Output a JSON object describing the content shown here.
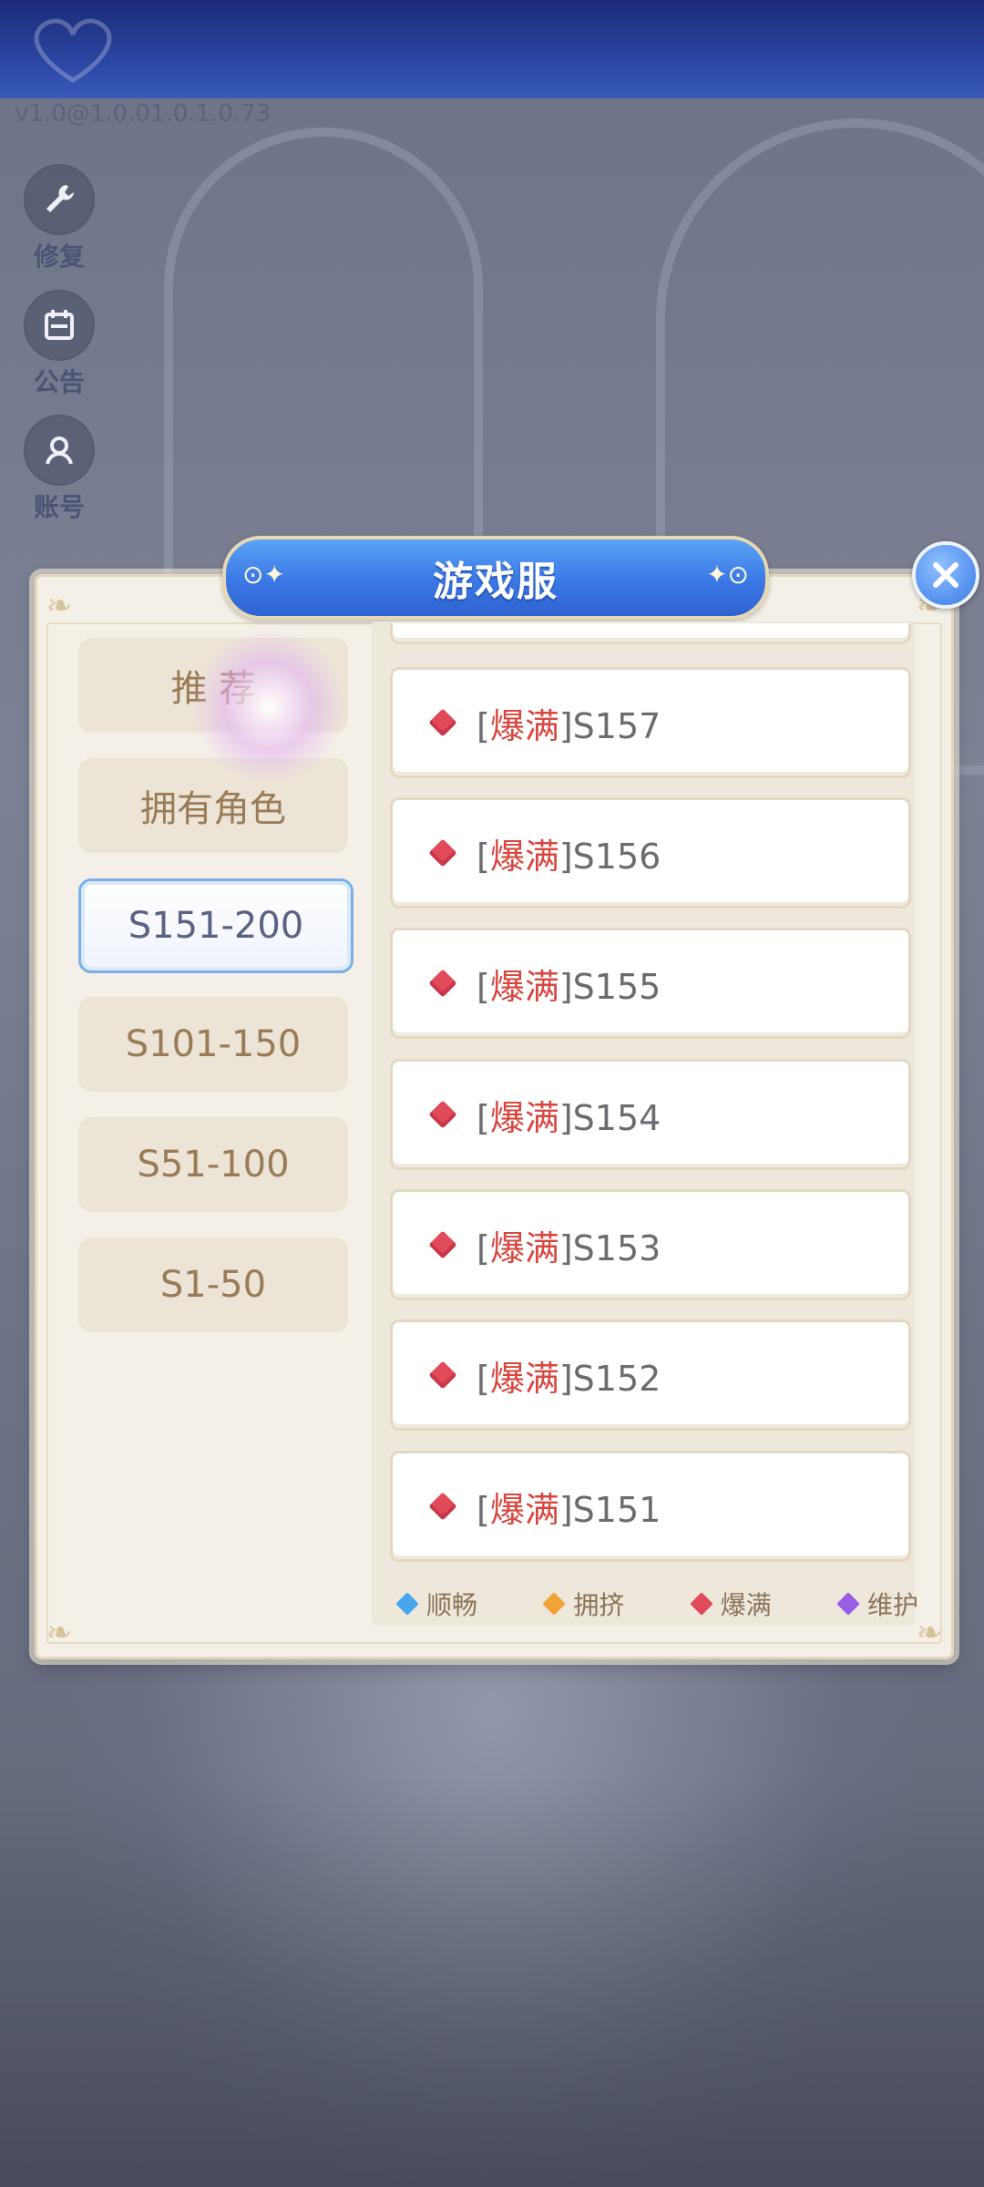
{
  "app": {
    "version": "v1.0@1.0.01.0.1.0.73"
  },
  "side_menu": [
    {
      "label": "修复",
      "icon": "wrench-icon"
    },
    {
      "label": "公告",
      "icon": "calendar-icon"
    },
    {
      "label": "账号",
      "icon": "account-icon"
    }
  ],
  "dialog": {
    "title": "游戏服",
    "close_icon": "close-icon"
  },
  "tabs": [
    {
      "label": "推 荐",
      "active": false
    },
    {
      "label": "拥有角色",
      "active": false
    },
    {
      "label": "S151-200",
      "active": true
    },
    {
      "label": "S101-150",
      "active": false
    },
    {
      "label": "S51-100",
      "active": false
    },
    {
      "label": "S1-50",
      "active": false
    }
  ],
  "servers": [
    {
      "bracket_open": "[",
      "status": "爆满",
      "name": "]S157"
    },
    {
      "bracket_open": "[",
      "status": "爆满",
      "name": "]S156"
    },
    {
      "bracket_open": "[",
      "status": "爆满",
      "name": "]S155"
    },
    {
      "bracket_open": "[",
      "status": "爆满",
      "name": "]S154"
    },
    {
      "bracket_open": "[",
      "status": "爆满",
      "name": "]S153"
    },
    {
      "bracket_open": "[",
      "status": "爆满",
      "name": "]S152"
    },
    {
      "bracket_open": "[",
      "status": "爆满",
      "name": "]S151"
    }
  ],
  "legend": [
    {
      "label": "顺畅",
      "color": "#4aa6ec"
    },
    {
      "label": "拥挤",
      "color": "#f0a436"
    },
    {
      "label": "爆满",
      "color": "#e04a5a"
    },
    {
      "label": "维护",
      "color": "#9a5de6"
    }
  ]
}
